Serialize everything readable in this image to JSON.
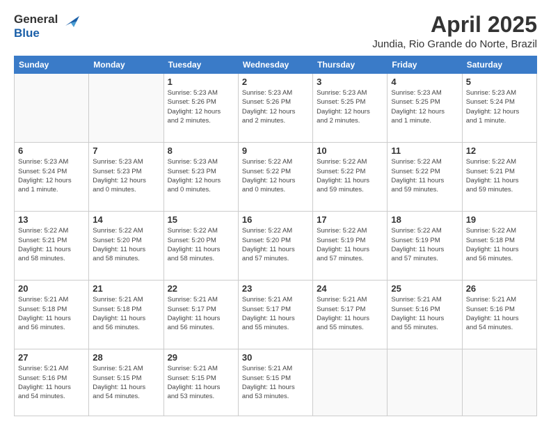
{
  "logo": {
    "general": "General",
    "blue": "Blue"
  },
  "header": {
    "month": "April 2025",
    "location": "Jundia, Rio Grande do Norte, Brazil"
  },
  "weekdays": [
    "Sunday",
    "Monday",
    "Tuesday",
    "Wednesday",
    "Thursday",
    "Friday",
    "Saturday"
  ],
  "weeks": [
    [
      {
        "day": "",
        "detail": ""
      },
      {
        "day": "",
        "detail": ""
      },
      {
        "day": "1",
        "detail": "Sunrise: 5:23 AM\nSunset: 5:26 PM\nDaylight: 12 hours\nand 2 minutes."
      },
      {
        "day": "2",
        "detail": "Sunrise: 5:23 AM\nSunset: 5:26 PM\nDaylight: 12 hours\nand 2 minutes."
      },
      {
        "day": "3",
        "detail": "Sunrise: 5:23 AM\nSunset: 5:25 PM\nDaylight: 12 hours\nand 2 minutes."
      },
      {
        "day": "4",
        "detail": "Sunrise: 5:23 AM\nSunset: 5:25 PM\nDaylight: 12 hours\nand 1 minute."
      },
      {
        "day": "5",
        "detail": "Sunrise: 5:23 AM\nSunset: 5:24 PM\nDaylight: 12 hours\nand 1 minute."
      }
    ],
    [
      {
        "day": "6",
        "detail": "Sunrise: 5:23 AM\nSunset: 5:24 PM\nDaylight: 12 hours\nand 1 minute."
      },
      {
        "day": "7",
        "detail": "Sunrise: 5:23 AM\nSunset: 5:23 PM\nDaylight: 12 hours\nand 0 minutes."
      },
      {
        "day": "8",
        "detail": "Sunrise: 5:23 AM\nSunset: 5:23 PM\nDaylight: 12 hours\nand 0 minutes."
      },
      {
        "day": "9",
        "detail": "Sunrise: 5:22 AM\nSunset: 5:22 PM\nDaylight: 12 hours\nand 0 minutes."
      },
      {
        "day": "10",
        "detail": "Sunrise: 5:22 AM\nSunset: 5:22 PM\nDaylight: 11 hours\nand 59 minutes."
      },
      {
        "day": "11",
        "detail": "Sunrise: 5:22 AM\nSunset: 5:22 PM\nDaylight: 11 hours\nand 59 minutes."
      },
      {
        "day": "12",
        "detail": "Sunrise: 5:22 AM\nSunset: 5:21 PM\nDaylight: 11 hours\nand 59 minutes."
      }
    ],
    [
      {
        "day": "13",
        "detail": "Sunrise: 5:22 AM\nSunset: 5:21 PM\nDaylight: 11 hours\nand 58 minutes."
      },
      {
        "day": "14",
        "detail": "Sunrise: 5:22 AM\nSunset: 5:20 PM\nDaylight: 11 hours\nand 58 minutes."
      },
      {
        "day": "15",
        "detail": "Sunrise: 5:22 AM\nSunset: 5:20 PM\nDaylight: 11 hours\nand 58 minutes."
      },
      {
        "day": "16",
        "detail": "Sunrise: 5:22 AM\nSunset: 5:20 PM\nDaylight: 11 hours\nand 57 minutes."
      },
      {
        "day": "17",
        "detail": "Sunrise: 5:22 AM\nSunset: 5:19 PM\nDaylight: 11 hours\nand 57 minutes."
      },
      {
        "day": "18",
        "detail": "Sunrise: 5:22 AM\nSunset: 5:19 PM\nDaylight: 11 hours\nand 57 minutes."
      },
      {
        "day": "19",
        "detail": "Sunrise: 5:22 AM\nSunset: 5:18 PM\nDaylight: 11 hours\nand 56 minutes."
      }
    ],
    [
      {
        "day": "20",
        "detail": "Sunrise: 5:21 AM\nSunset: 5:18 PM\nDaylight: 11 hours\nand 56 minutes."
      },
      {
        "day": "21",
        "detail": "Sunrise: 5:21 AM\nSunset: 5:18 PM\nDaylight: 11 hours\nand 56 minutes."
      },
      {
        "day": "22",
        "detail": "Sunrise: 5:21 AM\nSunset: 5:17 PM\nDaylight: 11 hours\nand 56 minutes."
      },
      {
        "day": "23",
        "detail": "Sunrise: 5:21 AM\nSunset: 5:17 PM\nDaylight: 11 hours\nand 55 minutes."
      },
      {
        "day": "24",
        "detail": "Sunrise: 5:21 AM\nSunset: 5:17 PM\nDaylight: 11 hours\nand 55 minutes."
      },
      {
        "day": "25",
        "detail": "Sunrise: 5:21 AM\nSunset: 5:16 PM\nDaylight: 11 hours\nand 55 minutes."
      },
      {
        "day": "26",
        "detail": "Sunrise: 5:21 AM\nSunset: 5:16 PM\nDaylight: 11 hours\nand 54 minutes."
      }
    ],
    [
      {
        "day": "27",
        "detail": "Sunrise: 5:21 AM\nSunset: 5:16 PM\nDaylight: 11 hours\nand 54 minutes."
      },
      {
        "day": "28",
        "detail": "Sunrise: 5:21 AM\nSunset: 5:15 PM\nDaylight: 11 hours\nand 54 minutes."
      },
      {
        "day": "29",
        "detail": "Sunrise: 5:21 AM\nSunset: 5:15 PM\nDaylight: 11 hours\nand 53 minutes."
      },
      {
        "day": "30",
        "detail": "Sunrise: 5:21 AM\nSunset: 5:15 PM\nDaylight: 11 hours\nand 53 minutes."
      },
      {
        "day": "",
        "detail": ""
      },
      {
        "day": "",
        "detail": ""
      },
      {
        "day": "",
        "detail": ""
      }
    ]
  ]
}
